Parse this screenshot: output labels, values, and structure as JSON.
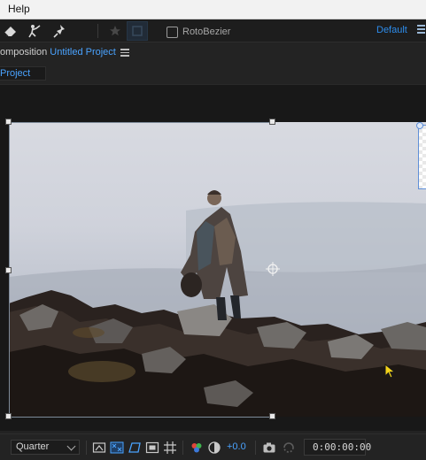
{
  "menubar": {
    "help_label": "Help"
  },
  "toolbar": {
    "tools": [
      "eraser-tool-icon",
      "roto-brush-tool-icon",
      "puppet-pin-tool-icon",
      "star-icon",
      "box-icon"
    ],
    "rotobezier_label": "RotoBezier",
    "rotobezier_checked": false,
    "workspace_label": "Default"
  },
  "panel": {
    "title_prefix": "omposition",
    "project_name": "Untitled Project",
    "subtab_label": "Project"
  },
  "footer": {
    "resolution": "Quarter",
    "exposure": "+0.0",
    "timecode": "0:00:00:00"
  },
  "colors": {
    "accent": "#2d8ceb",
    "link": "#4aa3ff",
    "background": "#232323"
  }
}
